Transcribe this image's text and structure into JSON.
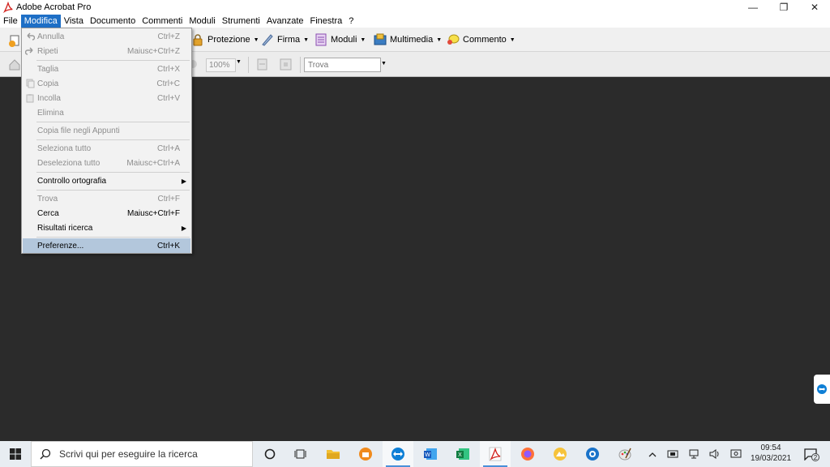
{
  "window": {
    "title": "Adobe Acrobat Pro",
    "controls": {
      "minimize": "—",
      "restore": "❐",
      "close": "✕"
    }
  },
  "menubar": [
    {
      "label": "File"
    },
    {
      "label": "Modifica",
      "active": true
    },
    {
      "label": "Vista"
    },
    {
      "label": "Documento"
    },
    {
      "label": "Commenti"
    },
    {
      "label": "Moduli"
    },
    {
      "label": "Strumenti"
    },
    {
      "label": "Avanzate"
    },
    {
      "label": "Finestra"
    },
    {
      "label": "?"
    }
  ],
  "toolbar": {
    "protezione": "Protezione",
    "firma": "Firma",
    "moduli": "Moduli",
    "multimedia": "Multimedia",
    "commento": "Commento",
    "zoom": "100%",
    "find_placeholder": "Trova"
  },
  "edit_menu": {
    "items": [
      {
        "label": "Annulla",
        "shortcut": "Ctrl+Z",
        "disabled": true,
        "icon": "undo-icon"
      },
      {
        "label": "Ripeti",
        "shortcut": "Maiusc+Ctrl+Z",
        "disabled": true,
        "icon": "redo-icon"
      },
      {
        "label": "Taglia",
        "shortcut": "Ctrl+X",
        "disabled": true
      },
      {
        "label": "Copia",
        "shortcut": "Ctrl+C",
        "disabled": true,
        "icon": "copy-icon"
      },
      {
        "label": "Incolla",
        "shortcut": "Ctrl+V",
        "disabled": true,
        "icon": "paste-icon"
      },
      {
        "label": "Elimina",
        "shortcut": "",
        "disabled": true
      },
      {
        "label": "Copia file negli Appunti",
        "shortcut": "",
        "disabled": true
      },
      {
        "label": "Seleziona tutto",
        "shortcut": "Ctrl+A",
        "disabled": true
      },
      {
        "label": "Deseleziona tutto",
        "shortcut": "Maiusc+Ctrl+A",
        "disabled": true
      },
      {
        "label": "Controllo ortografia",
        "shortcut": "",
        "disabled": false,
        "submenu": true
      },
      {
        "label": "Trova",
        "shortcut": "Ctrl+F",
        "disabled": true
      },
      {
        "label": "Cerca",
        "shortcut": "Maiusc+Ctrl+F",
        "disabled": false
      },
      {
        "label": "Risultati ricerca",
        "shortcut": "",
        "disabled": false,
        "submenu": true
      },
      {
        "label": "Preferenze...",
        "shortcut": "Ctrl+K",
        "disabled": false,
        "highlighted": true
      }
    ],
    "submenu_arrow": "▶"
  },
  "taskbar": {
    "search_placeholder": "Scrivi qui per eseguire la ricerca",
    "clock_time": "09:54",
    "clock_date": "19/03/2021",
    "notification_count": "2",
    "tray_chevron": "^"
  },
  "colors": {
    "menu_active": "#1e6fc6",
    "menu_highlight": "#b3c7dc",
    "workspace": "#2b2b2b"
  }
}
